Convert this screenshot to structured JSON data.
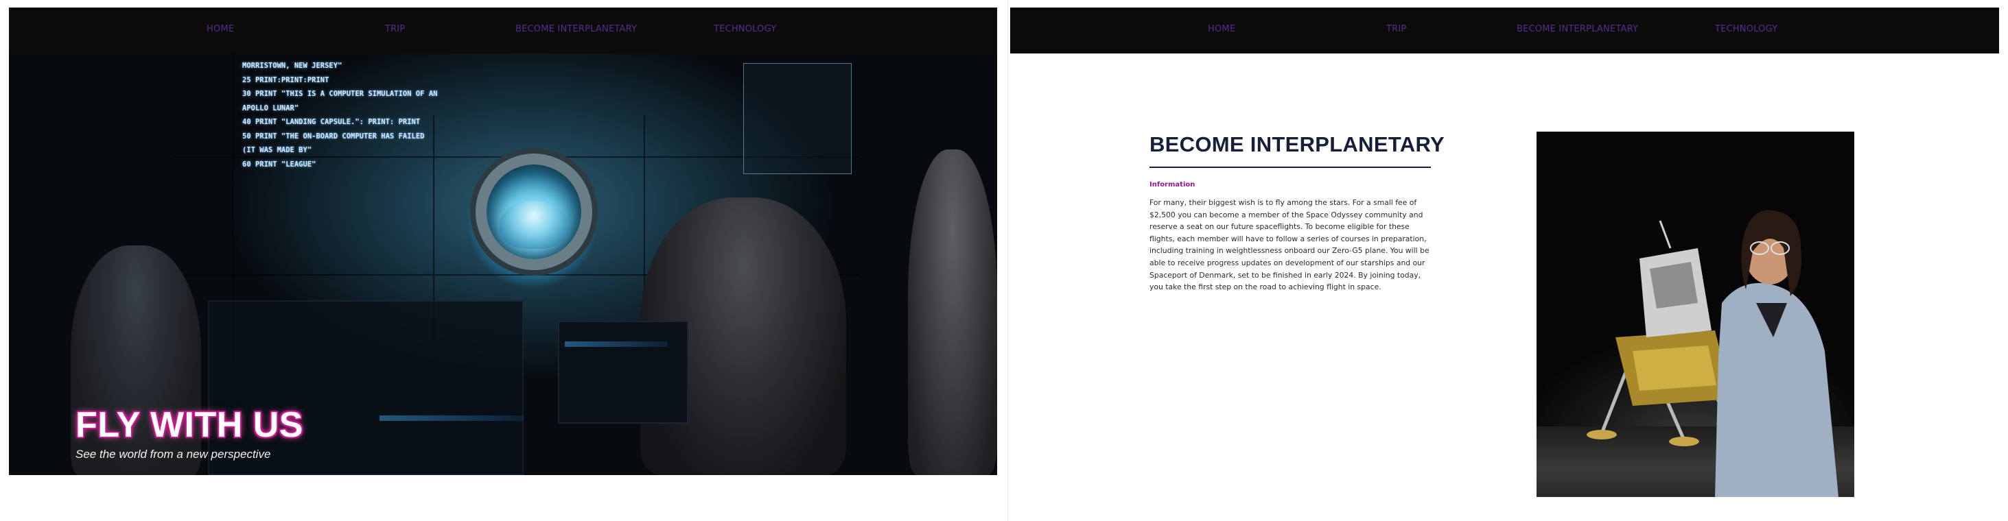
{
  "left": {
    "nav": {
      "items": [
        "HOME",
        "TRIP",
        "BECOME INTERPLANETARY",
        "TECHNOLOGY"
      ]
    },
    "hero": {
      "code_lines": [
        "MORRISTOWN, NEW JERSEY\"",
        "25 PRINT:PRINT:PRINT",
        "30 PRINT \"THIS IS A COMPUTER SIMULATION OF AN",
        "APOLLO LUNAR\"",
        "40 PRINT \"LANDING CAPSULE.\": PRINT: PRINT",
        "50 PRINT \"THE ON-BOARD COMPUTER HAS FAILED",
        "(IT WAS MADE BY\"",
        "60 PRINT \"LEAGUE\""
      ],
      "title": "FLY WITH US",
      "subtitle": "See the world from a new perspective"
    }
  },
  "right": {
    "nav": {
      "items": [
        "HOME",
        "TRIP",
        "BECOME INTERPLANETARY",
        "TECHNOLOGY"
      ]
    },
    "section": {
      "title": "BECOME INTERPLANETARY",
      "label": "Information",
      "body": "For many, their biggest wish is to fly among the stars. For a small fee of $2,500 you can become a member of the Space Odyssey community and reserve a seat on our future spaceflights. To become eligible for these flights, each member will have to follow a series of courses in preparation, including training in weightlessness onboard our Zero-G5 plane. You will be able to receive progress updates on development of our starships and our Spaceport of Denmark, set to be finished in early 2024. By joining today, you take the first step on the road to achieving flight in space."
    }
  },
  "colors": {
    "nav_bg": "#0b0b0c",
    "nav_text": "#5b2a8e",
    "title_navy": "#141f3a",
    "label_magenta": "#a01486",
    "hero_title_outline": "#c0138a"
  }
}
